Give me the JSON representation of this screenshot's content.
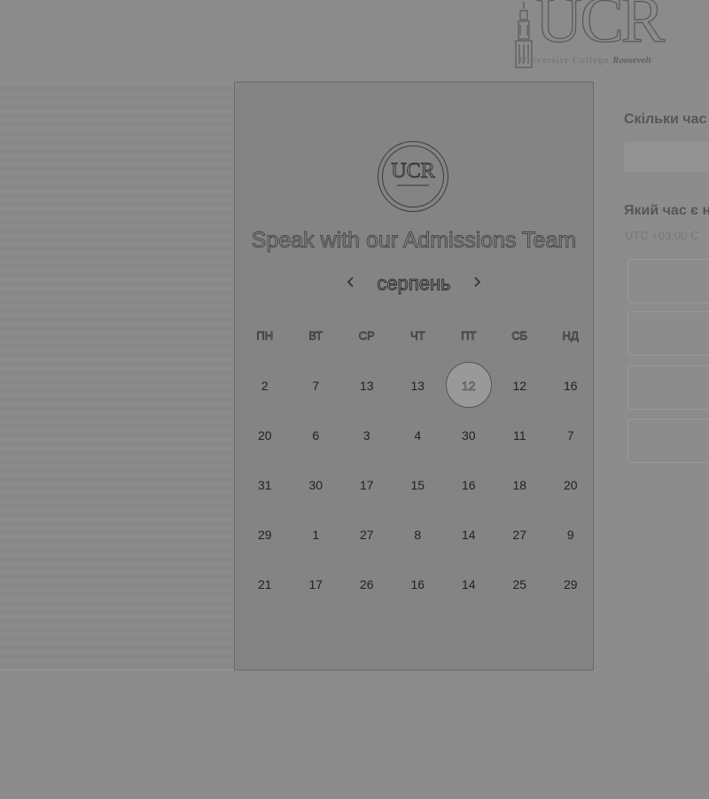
{
  "header": {
    "logo": {
      "mark": "UCR",
      "subtitle_main": "University College",
      "subtitle_name": "Roosevelt"
    }
  },
  "widget": {
    "logo_mark": "UCR",
    "title": "Speak with our Admissions Team",
    "month": "серпень",
    "prev_icon": "chevron-left-icon",
    "next_icon": "chevron-right-icon",
    "weekdays": [
      "ПН",
      "ВТ",
      "СР",
      "ЧТ",
      "ПТ",
      "СБ",
      "НД"
    ],
    "weeks": [
      [
        "2",
        "7",
        "13",
        "13",
        "12",
        "12",
        "16"
      ],
      [
        "20",
        "6",
        "3",
        "4",
        "30",
        "11",
        "7"
      ],
      [
        "31",
        "30",
        "17",
        "15",
        "16",
        "18",
        "20"
      ],
      [
        "29",
        "1",
        "27",
        "8",
        "14",
        "27",
        "9"
      ],
      [
        "21",
        "17",
        "26",
        "16",
        "14",
        "25",
        "29"
      ]
    ],
    "selected_day": "12"
  },
  "booking": {
    "duration_question": "Скільки час",
    "time_question": "Який час є н",
    "timezone": "UTC +03:00 C"
  },
  "colors": {
    "overlay": "#8a8a8a",
    "widget_bg": "#848484",
    "selected_day_bg": "#999999"
  }
}
